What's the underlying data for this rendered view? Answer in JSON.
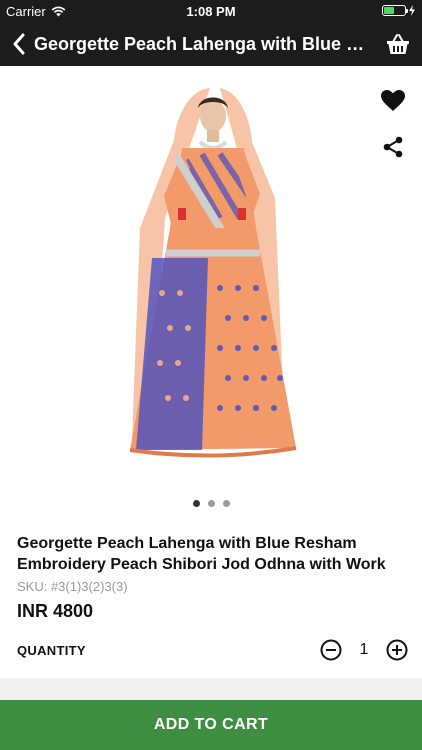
{
  "status_bar": {
    "carrier": "Carrier",
    "time": "1:08 PM",
    "battery_level": 0.5
  },
  "nav": {
    "title": "Georgette Peach Lahenga with Blue Resham",
    "back_icon": "chevron-left-icon",
    "cart_icon": "basket-icon"
  },
  "product": {
    "image_icon": "product-photo",
    "favorite_icon": "heart-icon",
    "share_icon": "share-icon",
    "carousel": {
      "count": 3,
      "active_index": 0
    },
    "title": "Georgette Peach Lahenga with Blue Resham Embroidery Peach Shibori Jod Odhna with Work",
    "sku": "SKU: #3(1)3(2)3(3)",
    "price": "INR 4800"
  },
  "quantity": {
    "label": "QUANTITY",
    "value": "1"
  },
  "actions": {
    "add_to_cart": "ADD TO CART"
  },
  "colors": {
    "header_bg": "#1c1c1c",
    "accent_green": "#3e8e41",
    "garment_peach": "#f39a6a",
    "garment_blue": "#4a4fc0"
  }
}
